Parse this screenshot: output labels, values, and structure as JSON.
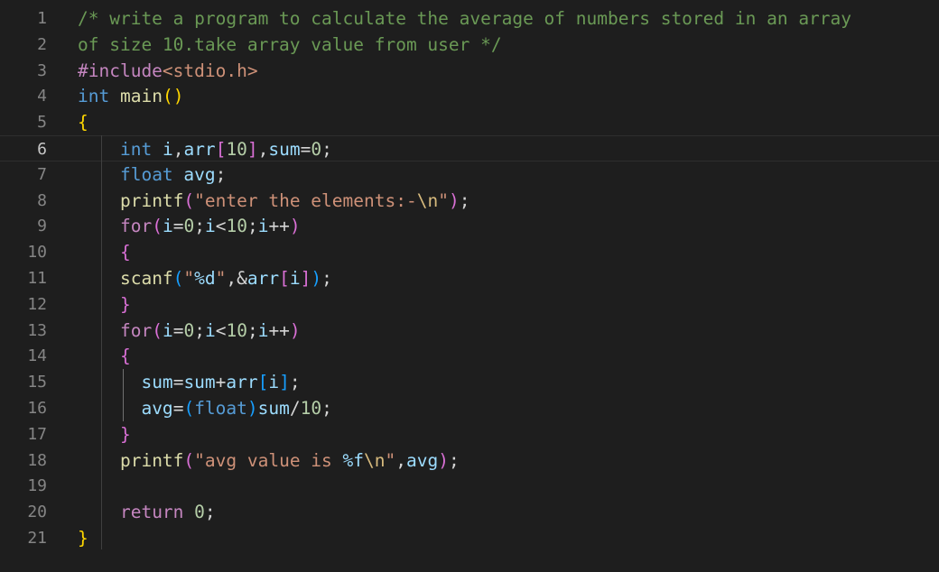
{
  "editor": {
    "current_line": 6,
    "lines": [
      {
        "n": "1",
        "tokens": [
          [
            "comment",
            "/* write a program to calculate the average of numbers stored in an array"
          ]
        ]
      },
      {
        "n": "2",
        "tokens": [
          [
            "comment",
            "of size 10.take array value from user */"
          ]
        ]
      },
      {
        "n": "3",
        "tokens": [
          [
            "control",
            "#include"
          ],
          [
            "string",
            "<stdio.h>"
          ]
        ]
      },
      {
        "n": "4",
        "tokens": [
          [
            "keyword",
            "int"
          ],
          [
            "punct",
            " "
          ],
          [
            "function",
            "main"
          ],
          [
            "brace1",
            "()"
          ]
        ]
      },
      {
        "n": "5",
        "tokens": [
          [
            "brace1",
            "{"
          ]
        ]
      },
      {
        "n": "6",
        "tokens": [
          [
            "punct",
            "    "
          ],
          [
            "keyword",
            "int"
          ],
          [
            "punct",
            " "
          ],
          [
            "variable",
            "i"
          ],
          [
            "punct",
            ","
          ],
          [
            "variable",
            "arr"
          ],
          [
            "brace2",
            "["
          ],
          [
            "number",
            "10"
          ],
          [
            "brace2",
            "]"
          ],
          [
            "punct",
            ","
          ],
          [
            "variable",
            "sum"
          ],
          [
            "punct",
            "="
          ],
          [
            "number",
            "0"
          ],
          [
            "punct",
            ";"
          ]
        ]
      },
      {
        "n": "7",
        "tokens": [
          [
            "punct",
            "    "
          ],
          [
            "keyword",
            "float"
          ],
          [
            "punct",
            " "
          ],
          [
            "variable",
            "avg"
          ],
          [
            "punct",
            ";"
          ]
        ]
      },
      {
        "n": "8",
        "tokens": [
          [
            "punct",
            "    "
          ],
          [
            "function",
            "printf"
          ],
          [
            "brace2",
            "("
          ],
          [
            "string",
            "\"enter the elements:-"
          ],
          [
            "escape",
            "\\n"
          ],
          [
            "string",
            "\""
          ],
          [
            "brace2",
            ")"
          ],
          [
            "punct",
            ";"
          ]
        ]
      },
      {
        "n": "9",
        "tokens": [
          [
            "punct",
            "    "
          ],
          [
            "control",
            "for"
          ],
          [
            "brace2",
            "("
          ],
          [
            "variable",
            "i"
          ],
          [
            "punct",
            "="
          ],
          [
            "number",
            "0"
          ],
          [
            "punct",
            ";"
          ],
          [
            "variable",
            "i"
          ],
          [
            "punct",
            "<"
          ],
          [
            "number",
            "10"
          ],
          [
            "punct",
            ";"
          ],
          [
            "variable",
            "i"
          ],
          [
            "punct",
            "++"
          ],
          [
            "brace2",
            ")"
          ]
        ]
      },
      {
        "n": "10",
        "tokens": [
          [
            "punct",
            "    "
          ],
          [
            "brace2",
            "{"
          ]
        ]
      },
      {
        "n": "11",
        "tokens": [
          [
            "punct",
            "    "
          ],
          [
            "function",
            "scanf"
          ],
          [
            "brace3",
            "("
          ],
          [
            "string",
            "\""
          ],
          [
            "format",
            "%d"
          ],
          [
            "string",
            "\""
          ],
          [
            "punct",
            ",&"
          ],
          [
            "variable",
            "arr"
          ],
          [
            "brace2",
            "["
          ],
          [
            "variable",
            "i"
          ],
          [
            "brace2",
            "]"
          ],
          [
            "brace3",
            ")"
          ],
          [
            "punct",
            ";"
          ]
        ]
      },
      {
        "n": "12",
        "tokens": [
          [
            "punct",
            "    "
          ],
          [
            "brace2",
            "}"
          ]
        ]
      },
      {
        "n": "13",
        "tokens": [
          [
            "punct",
            "    "
          ],
          [
            "control",
            "for"
          ],
          [
            "brace2",
            "("
          ],
          [
            "variable",
            "i"
          ],
          [
            "punct",
            "="
          ],
          [
            "number",
            "0"
          ],
          [
            "punct",
            ";"
          ],
          [
            "variable",
            "i"
          ],
          [
            "punct",
            "<"
          ],
          [
            "number",
            "10"
          ],
          [
            "punct",
            ";"
          ],
          [
            "variable",
            "i"
          ],
          [
            "punct",
            "++"
          ],
          [
            "brace2",
            ")"
          ]
        ]
      },
      {
        "n": "14",
        "tokens": [
          [
            "punct",
            "    "
          ],
          [
            "brace2",
            "{"
          ]
        ]
      },
      {
        "n": "15",
        "tokens": [
          [
            "punct",
            "      "
          ],
          [
            "variable",
            "sum"
          ],
          [
            "punct",
            "="
          ],
          [
            "variable",
            "sum"
          ],
          [
            "punct",
            "+"
          ],
          [
            "variable",
            "arr"
          ],
          [
            "brace3",
            "["
          ],
          [
            "variable",
            "i"
          ],
          [
            "brace3",
            "]"
          ],
          [
            "punct",
            ";"
          ]
        ]
      },
      {
        "n": "16",
        "tokens": [
          [
            "punct",
            "      "
          ],
          [
            "variable",
            "avg"
          ],
          [
            "punct",
            "="
          ],
          [
            "brace3",
            "("
          ],
          [
            "keyword",
            "float"
          ],
          [
            "brace3",
            ")"
          ],
          [
            "variable",
            "sum"
          ],
          [
            "punct",
            "/"
          ],
          [
            "number",
            "10"
          ],
          [
            "punct",
            ";"
          ]
        ]
      },
      {
        "n": "17",
        "tokens": [
          [
            "punct",
            "    "
          ],
          [
            "brace2",
            "}"
          ]
        ]
      },
      {
        "n": "18",
        "tokens": [
          [
            "punct",
            "    "
          ],
          [
            "function",
            "printf"
          ],
          [
            "brace2",
            "("
          ],
          [
            "string",
            "\"avg value is "
          ],
          [
            "format",
            "%f"
          ],
          [
            "escape",
            "\\n"
          ],
          [
            "string",
            "\""
          ],
          [
            "punct",
            ","
          ],
          [
            "variable",
            "avg"
          ],
          [
            "brace2",
            ")"
          ],
          [
            "punct",
            ";"
          ]
        ]
      },
      {
        "n": "19",
        "tokens": []
      },
      {
        "n": "20",
        "tokens": [
          [
            "punct",
            "    "
          ],
          [
            "control",
            "return"
          ],
          [
            "punct",
            " "
          ],
          [
            "number",
            "0"
          ],
          [
            "punct",
            ";"
          ]
        ]
      },
      {
        "n": "21",
        "tokens": [
          [
            "brace1",
            "}"
          ]
        ]
      }
    ]
  }
}
